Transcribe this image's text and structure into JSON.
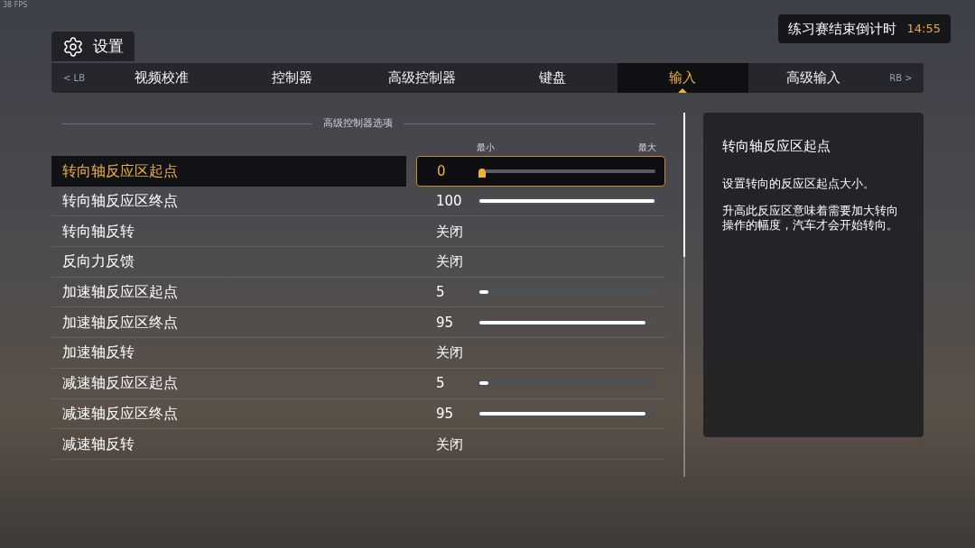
{
  "fps": "38 FPS",
  "header": {
    "title": "设置"
  },
  "timer": {
    "label": "练习赛结束倒计时",
    "time": "14:55"
  },
  "tabs": {
    "prev_hint": "< LB",
    "next_hint": "RB >",
    "items": [
      {
        "label": "视频校准",
        "selected": false
      },
      {
        "label": "控制器",
        "selected": false
      },
      {
        "label": "高级控制器",
        "selected": false
      },
      {
        "label": "键盘",
        "selected": false
      },
      {
        "label": "输入",
        "selected": true
      },
      {
        "label": "高级输入",
        "selected": false
      }
    ]
  },
  "section": {
    "title": "高级控制器选项",
    "min_label": "最小",
    "max_label": "最大"
  },
  "rows": [
    {
      "label": "转向轴反应区起点",
      "kind": "slider",
      "value": "0",
      "level": 0,
      "selected": true
    },
    {
      "label": "转向轴反应区终点",
      "kind": "slider",
      "value": "100",
      "level": 1,
      "selected": false
    },
    {
      "label": "转向轴反转",
      "kind": "toggle",
      "value": "关闭",
      "selected": false
    },
    {
      "label": "反向力反馈",
      "kind": "toggle",
      "value": "关闭",
      "selected": false
    },
    {
      "label": "加速轴反应区起点",
      "kind": "slider",
      "value": "5",
      "level": 0.05,
      "selected": false
    },
    {
      "label": "加速轴反应区终点",
      "kind": "slider",
      "value": "95",
      "level": 0.95,
      "selected": false
    },
    {
      "label": "加速轴反转",
      "kind": "toggle",
      "value": "关闭",
      "selected": false
    },
    {
      "label": "减速轴反应区起点",
      "kind": "slider",
      "value": "5",
      "level": 0.05,
      "selected": false
    },
    {
      "label": "减速轴反应区终点",
      "kind": "slider",
      "value": "95",
      "level": 0.95,
      "selected": false
    },
    {
      "label": "减速轴反转",
      "kind": "toggle",
      "value": "关闭",
      "selected": false
    }
  ],
  "description": {
    "title": "转向轴反应区起点",
    "paragraphs": [
      "设置转向的反应区起点大小。",
      "升高此反应区意味着需要加大转向操作的幅度，汽车才会开始转向。"
    ]
  }
}
